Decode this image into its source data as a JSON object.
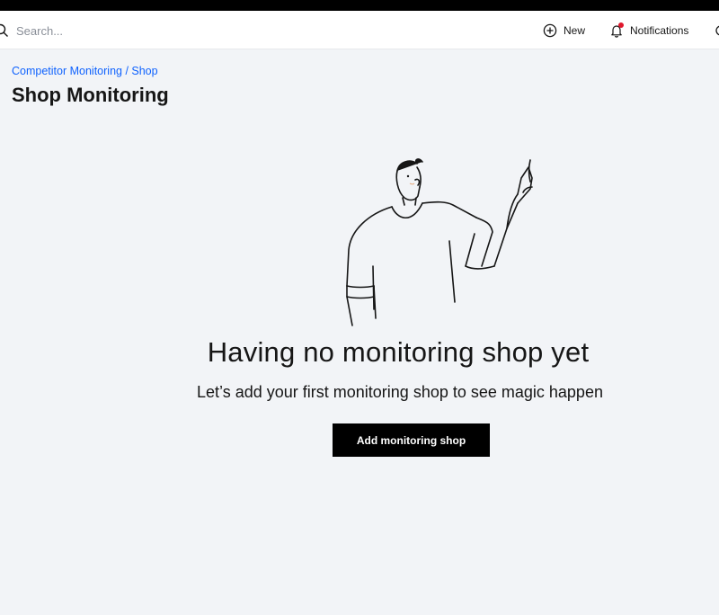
{
  "header": {
    "search_placeholder": "Search...",
    "new_label": "New",
    "notifications_label": "Notifications"
  },
  "breadcrumb": {
    "parent": "Competitor Monitoring",
    "separator": " / ",
    "current": "Shop"
  },
  "page": {
    "title": "Shop Monitoring"
  },
  "empty_state": {
    "title": "Having no monitoring shop yet",
    "subtitle": "Let’s add your first monitoring shop to see magic happen",
    "button_label": "Add monitoring shop",
    "illustration_icon": "person-pointing-up-illustration"
  },
  "colors": {
    "link": "#0f62fe",
    "background": "#f2f4f7",
    "primary_button": "#000000",
    "notification_dot": "#e0182d"
  }
}
